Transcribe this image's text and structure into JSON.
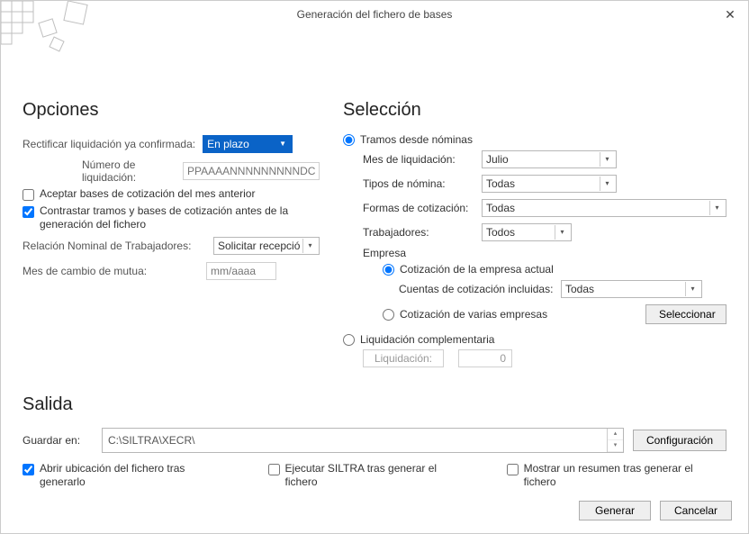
{
  "window": {
    "title": "Generación del fichero de bases"
  },
  "opciones": {
    "heading": "Opciones",
    "rectificar_label": "Rectificar liquidación ya confirmada:",
    "rectificar_value": "En plazo",
    "num_liq_label": "Número de liquidación:",
    "num_liq_placeholder": "PPAAAANNNNNNNNNDC",
    "aceptar_bases_label": "Aceptar bases de cotización del mes anterior",
    "aceptar_bases_checked": false,
    "contrastar_label": "Contrastar tramos y bases de cotización antes de la generación del fichero",
    "contrastar_checked": true,
    "relacion_label": "Relación Nominal de Trabajadores:",
    "relacion_value": "Solicitar recepció",
    "mes_cambio_label": "Mes de cambio de mutua:",
    "mes_cambio_placeholder": "mm/aaaa"
  },
  "seleccion": {
    "heading": "Selección",
    "tramos_label": "Tramos desde nóminas",
    "tramos_selected": true,
    "mes_liq_label": "Mes de liquidación:",
    "mes_liq_value": "Julio",
    "tipos_label": "Tipos de nómina:",
    "tipos_value": "Todas",
    "formas_label": "Formas de cotización:",
    "formas_value": "Todas",
    "trabajadores_label": "Trabajadores:",
    "trabajadores_value": "Todos",
    "empresa_label": "Empresa",
    "empresa_actual_label": "Cotización de la empresa actual",
    "empresa_actual_selected": true,
    "cuentas_label": "Cuentas de cotización incluidas:",
    "cuentas_value": "Todas",
    "empresa_varias_label": "Cotización de varias empresas",
    "seleccionar_btn": "Seleccionar",
    "liq_comp_label": "Liquidación complementaria",
    "liq_comp_selected": false,
    "liq_box_label": "Liquidación:",
    "liq_value": "0"
  },
  "salida": {
    "heading": "Salida",
    "guardar_label": "Guardar en:",
    "path": "C:\\SILTRA\\XECR\\",
    "config_btn": "Configuración",
    "abrir_label": "Abrir ubicación del fichero tras generarlo",
    "abrir_checked": true,
    "ejecutar_label": "Ejecutar SILTRA tras generar el fichero",
    "ejecutar_checked": false,
    "resumen_label": "Mostrar un resumen tras generar el fichero",
    "resumen_checked": false
  },
  "footer": {
    "generar": "Generar",
    "cancelar": "Cancelar"
  }
}
